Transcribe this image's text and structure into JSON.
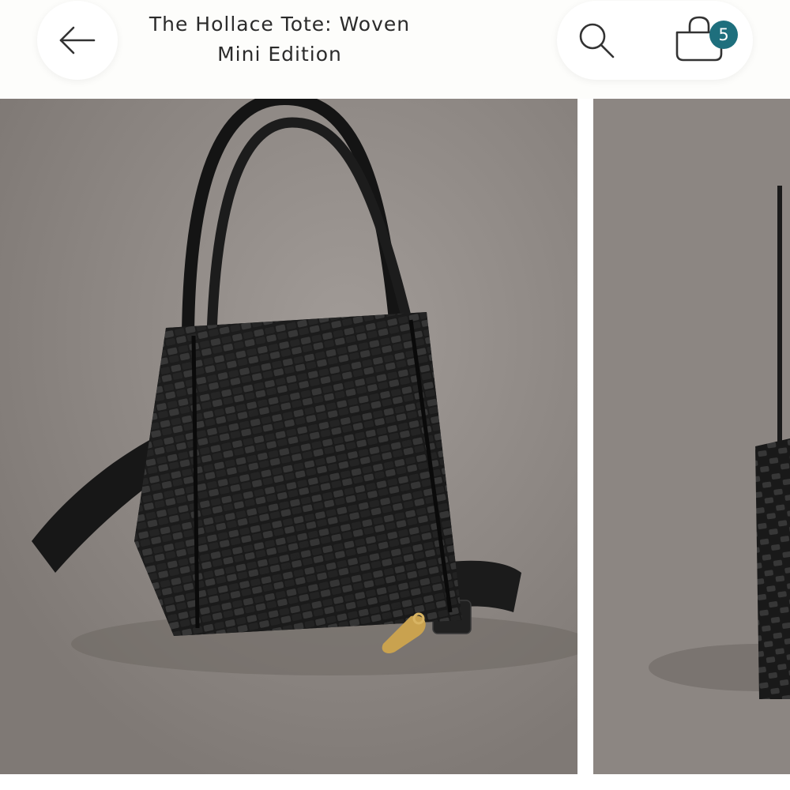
{
  "header": {
    "title": "The Hollace Tote: Woven Mini Edition",
    "back_icon": "arrow-left-icon",
    "search_icon": "search-icon",
    "cart_icon": "shopping-bag-icon",
    "cart_count": "5",
    "badge_color": "#1e6f7d"
  },
  "gallery": {
    "images": [
      {
        "alt": "Black woven leather mini tote bag with crossbody strap"
      },
      {
        "alt": "Black woven leather mini tote bag, alternate view"
      }
    ]
  }
}
